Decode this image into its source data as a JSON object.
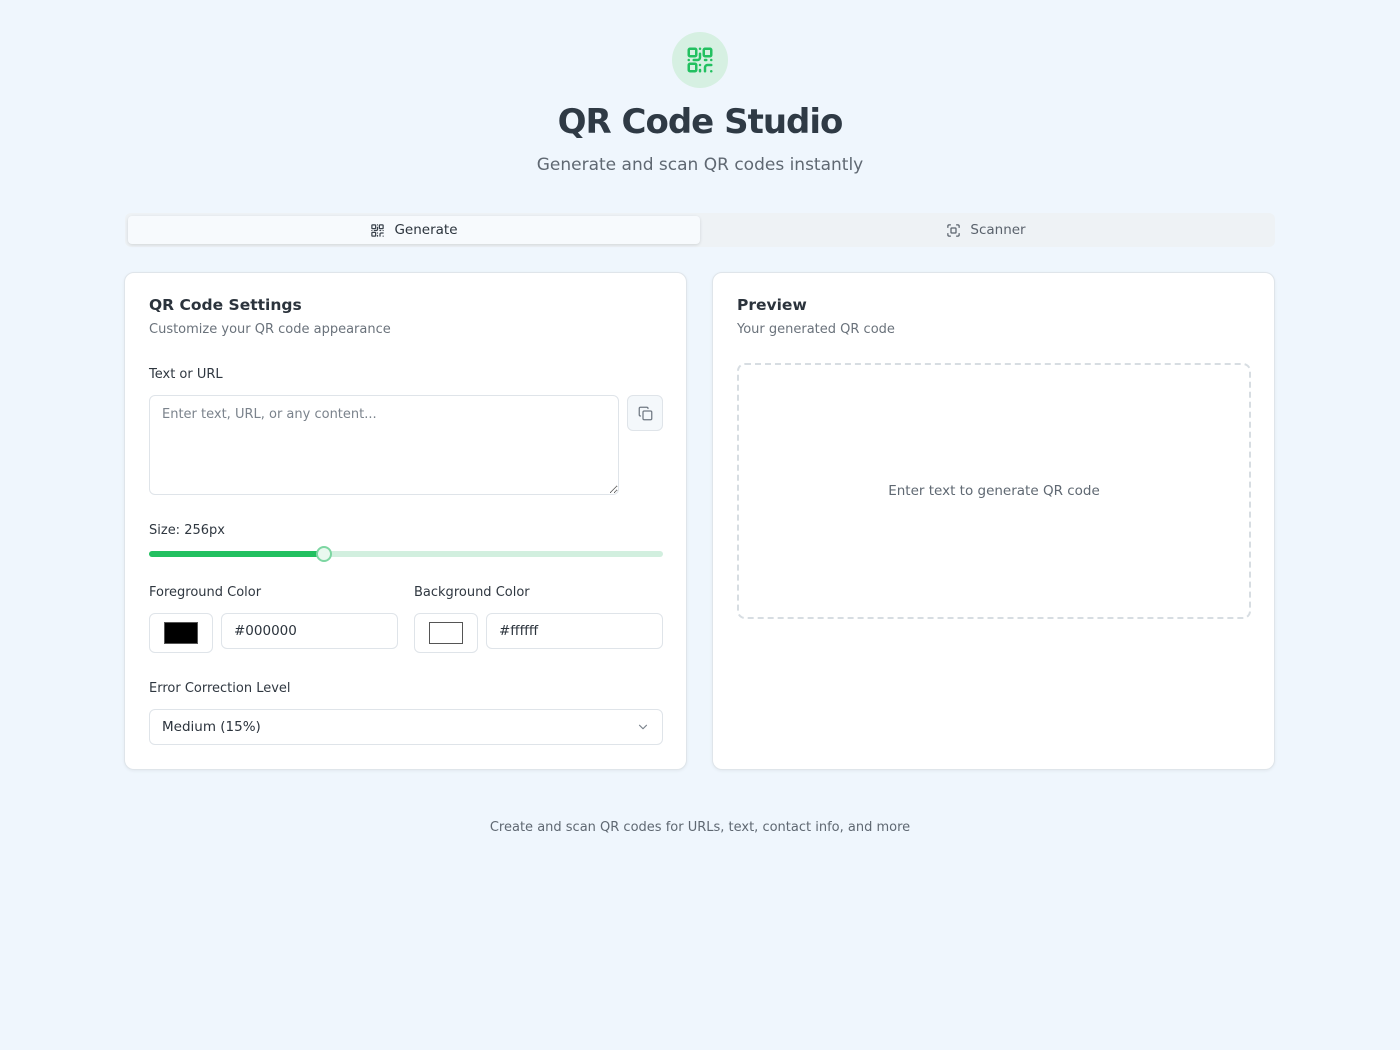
{
  "header": {
    "logo_icon": "qr-code-icon",
    "title": "QR Code Studio",
    "subtitle": "Generate and scan QR codes instantly"
  },
  "tabs": [
    {
      "label": "Generate",
      "icon": "qr-code-icon",
      "active": true
    },
    {
      "label": "Scanner",
      "icon": "scan-icon",
      "active": false
    }
  ],
  "settings": {
    "title": "QR Code Settings",
    "description": "Customize your QR code appearance",
    "text_label": "Text or URL",
    "text_value": "",
    "text_placeholder": "Enter text, URL, or any content...",
    "copy_icon": "copy-icon",
    "size_label": "Size: 256px",
    "size_fraction": 0.34,
    "foreground_label": "Foreground Color",
    "foreground_value": "#000000",
    "background_label": "Background Color",
    "background_value": "#ffffff",
    "error_label": "Error Correction Level",
    "error_value": "Medium (15%)"
  },
  "preview": {
    "title": "Preview",
    "description": "Your generated QR code",
    "empty_message": "Enter text to generate QR code"
  },
  "footer": {
    "text": "Create and scan QR codes for URLs, text, contact info, and more"
  },
  "colors": {
    "accent": "#22c060",
    "page_background": "#eff6fd"
  }
}
